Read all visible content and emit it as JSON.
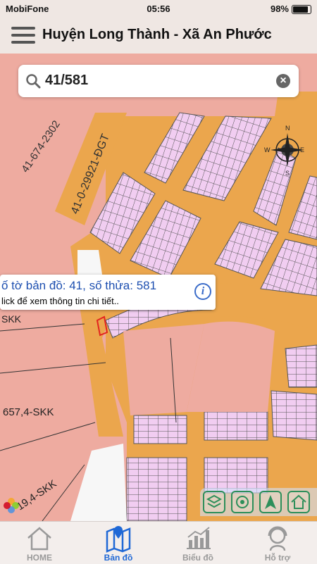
{
  "status": {
    "carrier": "MobiFone",
    "time": "05:56",
    "battery": "98%"
  },
  "header": {
    "title": "Huyện Long Thành - Xã An Phước"
  },
  "search": {
    "value": "41/581"
  },
  "map": {
    "road_labels": [
      "41-674-2302",
      "41-0-29921-ĐGT"
    ],
    "parcel_labels": [
      "SKK",
      "657,4-SKK",
      "19,4-SKK"
    ],
    "compass": {
      "n": "N",
      "s": "S",
      "e": "E",
      "w": "W"
    },
    "colors": {
      "land": "#eeaba0",
      "road": "#eba64d",
      "lot": "#f1cdf1",
      "blank": "#f7f7f7"
    }
  },
  "callout": {
    "title": "ố tờ bản đồ: 41, số thửa: 581",
    "subtitle": "lick để xem thông tin chi tiết.."
  },
  "tabs": [
    {
      "label": "HOME",
      "icon": "home-icon",
      "active": false
    },
    {
      "label": "Bản đồ",
      "icon": "map-icon",
      "active": true
    },
    {
      "label": "Biểu đồ",
      "icon": "chart-icon",
      "active": false
    },
    {
      "label": "Hỗ trợ",
      "icon": "support-icon",
      "active": false
    }
  ],
  "accent_color": "#1f68d6"
}
